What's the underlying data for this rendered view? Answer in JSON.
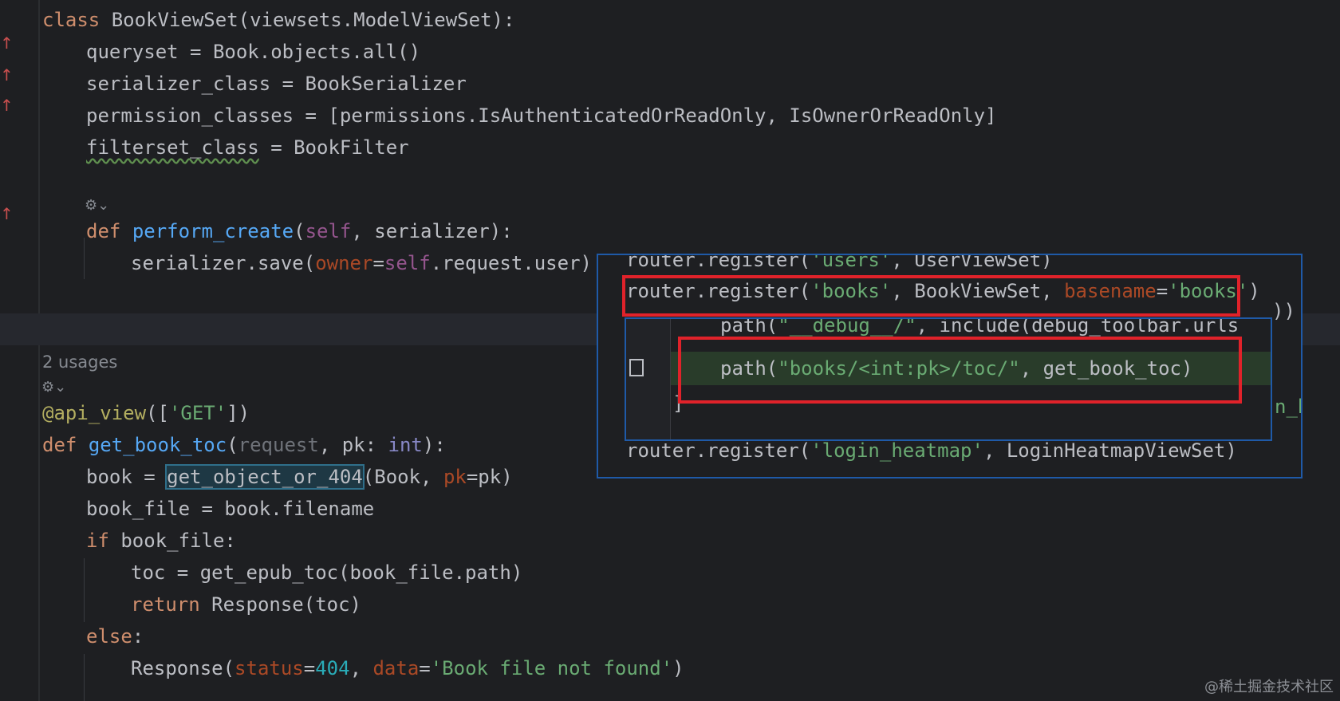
{
  "code": {
    "l1": {
      "kw": "class",
      "name": " BookViewSet(viewsets.ModelViewSet):"
    },
    "l2": "queryset = Book.objects.all()",
    "l3": "serializer_class = BookSerializer",
    "l4": "permission_classes = [permissions.IsAuthenticatedOrReadOnly, IsOwnerOrReadOnly]",
    "l5": {
      "name": "filterset_class",
      "rest": " = BookFilter"
    },
    "l7": {
      "kw": "def",
      "fn": "perform_create",
      "open": "(",
      "self": "self",
      "rest": ", serializer):"
    },
    "l8": {
      "a": "serializer.save(",
      "kw": "owner",
      "eq": "=",
      "self": "self",
      "b": ".request.user)"
    },
    "usages": "2 usages",
    "l11": {
      "dec": "@api_view",
      "a": "([",
      "str": "'GET'",
      "b": "])"
    },
    "l12": {
      "kw": "def",
      "fn": "get_book_toc",
      "a": "(",
      "p1": "request",
      "b": ", pk: ",
      "typ": "int",
      "c": "):"
    },
    "l13": {
      "a": "book = ",
      "hl": "get_object_or_404",
      "b": "(Book, ",
      "kw": "pk",
      "c": "=pk)"
    },
    "l14": "book_file = book.filename",
    "l15": {
      "kw": "if",
      "rest": " book_file:"
    },
    "l16": "toc = get_epub_toc(book_file.path)",
    "l17": {
      "kw": "return",
      "rest": " Response(toc)"
    },
    "l18": {
      "kw": "else",
      "rest": ":"
    },
    "l19": {
      "a": "Response(",
      "k1": "status",
      "eq1": "=",
      "num": "404",
      "b": ", ",
      "k2": "data",
      "eq2": "=",
      "str": "'Book file not found'",
      "c": ")"
    }
  },
  "popup": {
    "r1": {
      "a": "router.register(",
      "str": "'users'",
      "b": ", UserViewSet)"
    },
    "r2": {
      "a": "router.register(",
      "s1": "'books'",
      "b": ", BookViewSet, ",
      "kw": "basename",
      "eq": "=",
      "s2": "'books'",
      "c": ")"
    },
    "r3": {
      "a": "router.register(",
      "str": "'login_heatmap'",
      "b": ", LoginHeatmapViewSet)"
    },
    "inner": {
      "i1": {
        "a": "path(",
        "str": "\"__debug__/\"",
        "b": ", include(debug_toolbar.urls"
      },
      "i2": {
        "a": "path(",
        "str": "\"books/<int:pk>/toc/\"",
        "b": ", get_book_toc)"
      },
      "i3": "]",
      "i1_tail": "))",
      "edge": "n_b"
    }
  },
  "gutter": {
    "change_marker": "↑"
  },
  "icons": {
    "gear": "gear-icon"
  },
  "watermark": "@稀土掘金技术社区",
  "colors": {
    "highlight_red": "#e0222a",
    "popup_border": "#1f5aa8",
    "added_line": "#293c2a"
  }
}
